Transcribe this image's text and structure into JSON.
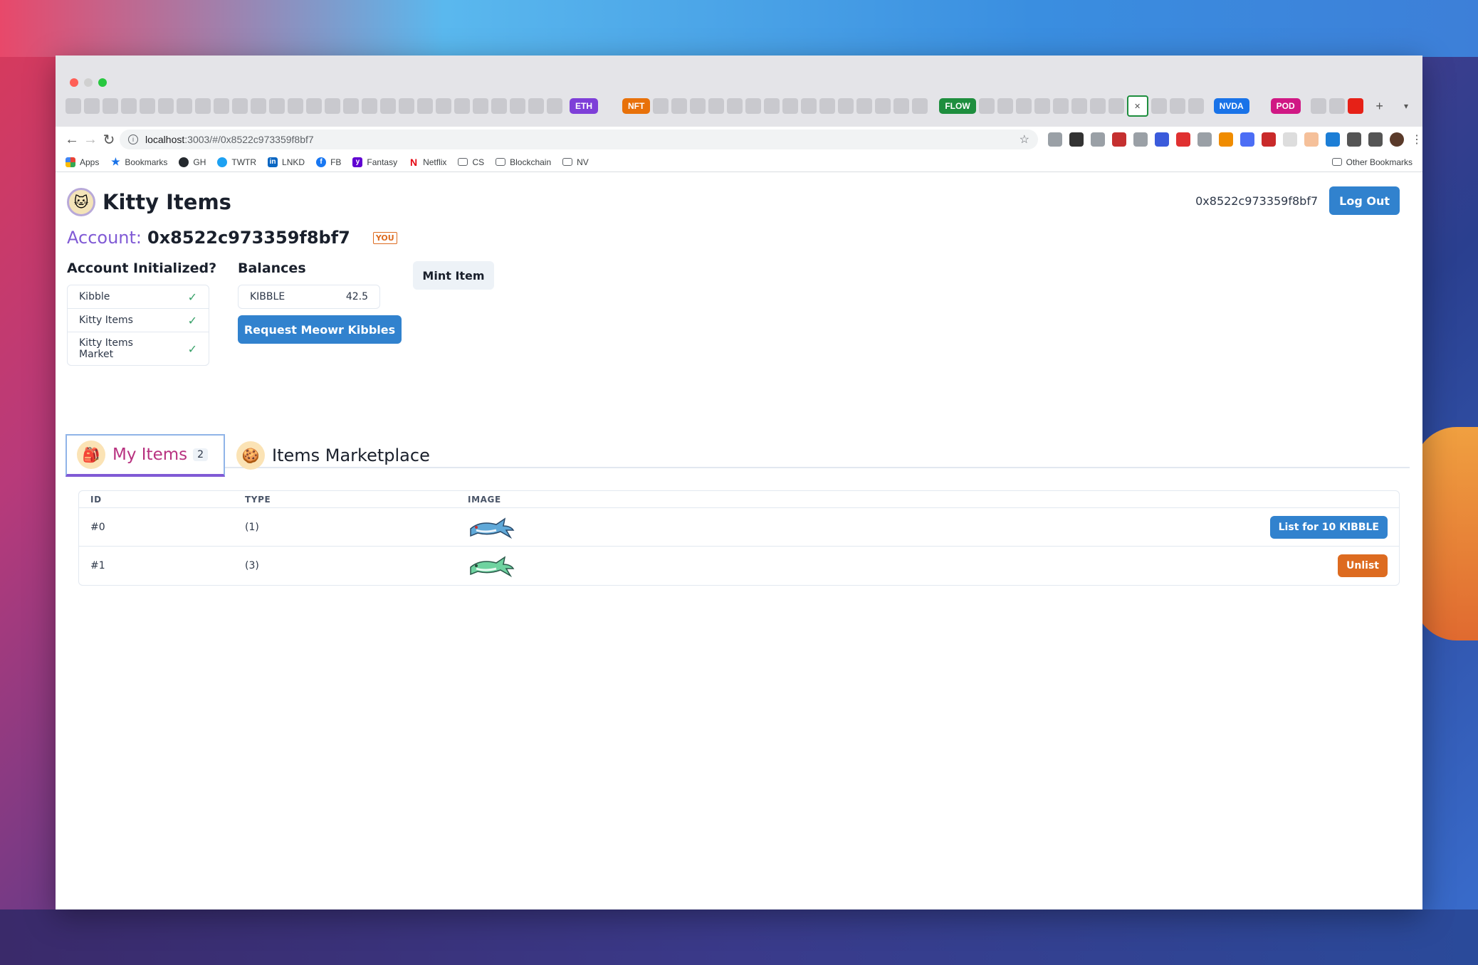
{
  "browser": {
    "tab_groups": [
      "ETH",
      "NFT",
      "FLOW",
      "NVDA",
      "POD"
    ],
    "url": {
      "host": "localhost",
      "rest": ":3003/#/0x8522c973359f8bf7"
    },
    "bookmarks": [
      {
        "label": "Apps",
        "icon": "apps-grid-icon"
      },
      {
        "label": "Bookmarks",
        "icon": "star-icon"
      },
      {
        "label": "GH",
        "icon": "github-icon"
      },
      {
        "label": "TWTR",
        "icon": "twitter-icon"
      },
      {
        "label": "LNKD",
        "icon": "linkedin-icon"
      },
      {
        "label": "FB",
        "icon": "facebook-icon"
      },
      {
        "label": "Fantasy",
        "icon": "yahoo-icon"
      },
      {
        "label": "Netflix",
        "icon": "netflix-icon"
      },
      {
        "label": "CS",
        "icon": "folder-icon"
      },
      {
        "label": "Blockchain",
        "icon": "folder-icon"
      },
      {
        "label": "NV",
        "icon": "folder-icon"
      }
    ],
    "other_bookmarks": "Other Bookmarks"
  },
  "app": {
    "title": "Kitty Items",
    "header_address": "0x8522c973359f8bf7",
    "logout_label": "Log Out",
    "account_label": "Account:",
    "account_value": "0x8522c973359f8bf7",
    "you_badge": "YOU",
    "init_title": "Account Initialized?",
    "init_items": [
      {
        "label": "Kibble"
      },
      {
        "label": "Kitty Items"
      },
      {
        "label": "Kitty Items Market"
      }
    ],
    "balances_title": "Balances",
    "balance": {
      "token": "KIBBLE",
      "amount": "42.5"
    },
    "request_label": "Request Meowr Kibbles",
    "mint_label": "Mint Item",
    "tabs": [
      {
        "label": "My Items",
        "count": "2"
      },
      {
        "label": "Items Marketplace"
      }
    ],
    "table": {
      "headers": [
        "ID",
        "TYPE",
        "IMAGE"
      ],
      "rows": [
        {
          "id": "#0",
          "type": "(1)",
          "action": "List for 10 KIBBLE"
        },
        {
          "id": "#1",
          "type": "(3)",
          "action": "Unlist"
        }
      ]
    }
  },
  "colors": {
    "accent_blue": "#3182ce",
    "accent_orange": "#dd6b20",
    "account_label": "#805ad5",
    "tab_active": "#b83280"
  }
}
